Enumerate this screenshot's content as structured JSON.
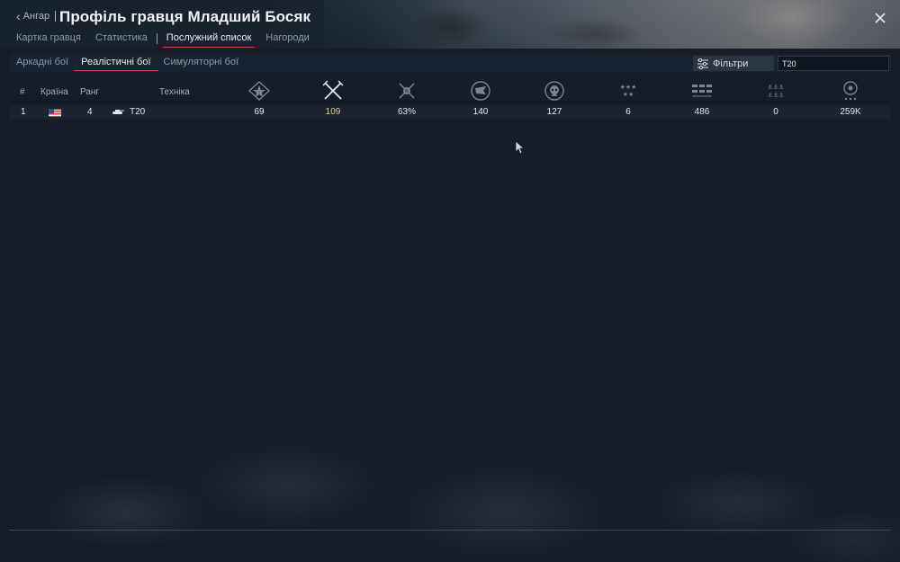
{
  "header": {
    "back_label": "Ангар",
    "title": "Профіль гравця Младший Босяк",
    "tabs": [
      {
        "label": "Картка гравця",
        "active": false
      },
      {
        "label": "Статистика",
        "active": false
      },
      {
        "label": "Послужний список",
        "active": true
      },
      {
        "label": "Нагороди",
        "active": false
      }
    ]
  },
  "modes": {
    "tabs": [
      {
        "label": "Аркадні бої",
        "active": false
      },
      {
        "label": "Реалістичні бої",
        "active": true
      },
      {
        "label": "Симуляторні бої",
        "active": false
      }
    ],
    "filter_label": "Фільтри",
    "search_value": "T20"
  },
  "table": {
    "headers": {
      "num": "#",
      "country": "Країна",
      "rank": "Ранг",
      "vehicle": "Техніка"
    },
    "stat_icons": [
      "battles-icon",
      "crossed-swords-icon",
      "win-rate-icon",
      "capture-flag-icon",
      "skull-icon",
      "stars-icon",
      "ground-targets-icon",
      "anchors-icon",
      "balloon-icon"
    ],
    "rows": [
      {
        "num": "1",
        "country_flag": "usa-flag",
        "rank": "4",
        "vehicle": "T20",
        "stats": [
          "69",
          "109",
          "63%",
          "140",
          "127",
          "6",
          "486",
          "0",
          "259K"
        ]
      }
    ]
  },
  "colors": {
    "accent_red": "#c24a3a",
    "highlight_gold": "#e8c88a",
    "background": "#141d28"
  }
}
